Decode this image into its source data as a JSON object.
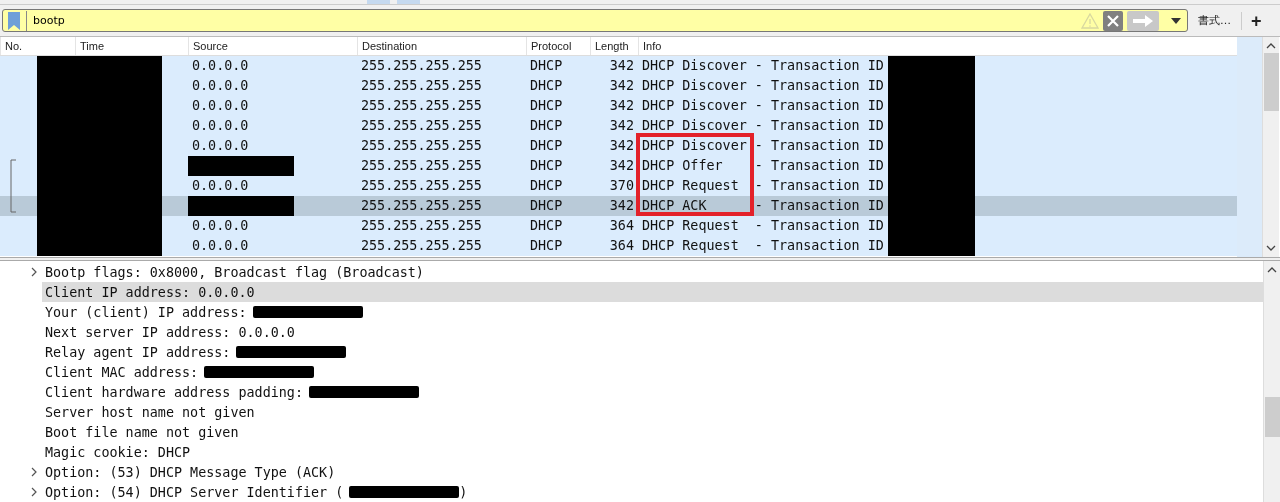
{
  "filter": {
    "value": "bootp",
    "format_label": "書式…",
    "add_label": "+"
  },
  "packet_list": {
    "columns": [
      "No.",
      "Time",
      "Source",
      "Destination",
      "Protocol",
      "Length",
      "Info"
    ],
    "rows": [
      {
        "source": "0.0.0.0",
        "source_redacted": false,
        "destination": "255.255.255.255",
        "protocol": "DHCP",
        "length": "342",
        "info": "DHCP Discover - Transaction ID",
        "related": false,
        "selected": false
      },
      {
        "source": "0.0.0.0",
        "source_redacted": false,
        "destination": "255.255.255.255",
        "protocol": "DHCP",
        "length": "342",
        "info": "DHCP Discover - Transaction ID",
        "related": false,
        "selected": false
      },
      {
        "source": "0.0.0.0",
        "source_redacted": false,
        "destination": "255.255.255.255",
        "protocol": "DHCP",
        "length": "342",
        "info": "DHCP Discover - Transaction ID",
        "related": false,
        "selected": false
      },
      {
        "source": "0.0.0.0",
        "source_redacted": false,
        "destination": "255.255.255.255",
        "protocol": "DHCP",
        "length": "342",
        "info": "DHCP Discover - Transaction ID",
        "related": false,
        "selected": false
      },
      {
        "source": "0.0.0.0",
        "source_redacted": false,
        "destination": "255.255.255.255",
        "protocol": "DHCP",
        "length": "342",
        "info": "DHCP Discover - Transaction ID",
        "related": false,
        "selected": false
      },
      {
        "source_redacted": true,
        "destination": "255.255.255.255",
        "protocol": "DHCP",
        "length": "342",
        "info": "DHCP Offer    - Transaction ID",
        "related": true,
        "selected": false
      },
      {
        "source": "0.0.0.0",
        "source_redacted": false,
        "destination": "255.255.255.255",
        "protocol": "DHCP",
        "length": "370",
        "info": "DHCP Request  - Transaction ID",
        "related": true,
        "selected": false
      },
      {
        "source_redacted": true,
        "destination": "255.255.255.255",
        "protocol": "DHCP",
        "length": "342",
        "info": "DHCP ACK      - Transaction ID",
        "related": true,
        "selected": true
      },
      {
        "source": "0.0.0.0",
        "source_redacted": false,
        "destination": "255.255.255.255",
        "protocol": "DHCP",
        "length": "364",
        "info": "DHCP Request  - Transaction ID",
        "related": false,
        "selected": false
      },
      {
        "source": "0.0.0.0",
        "source_redacted": false,
        "destination": "255.255.255.255",
        "protocol": "DHCP",
        "length": "364",
        "info": "DHCP Request  - Transaction ID",
        "related": false,
        "selected": false
      }
    ]
  },
  "details": [
    {
      "text": "Bootp flags: 0x8000, Broadcast flag (Broadcast)",
      "expandable": true,
      "redacted": false,
      "selected": false
    },
    {
      "text": "Client IP address: 0.0.0.0",
      "expandable": false,
      "redacted": false,
      "selected": true
    },
    {
      "text": "Your (client) IP address:",
      "expandable": false,
      "redacted": true,
      "selected": false
    },
    {
      "text": "Next server IP address: 0.0.0.0",
      "expandable": false,
      "redacted": false,
      "selected": false
    },
    {
      "text": "Relay agent IP address:",
      "expandable": false,
      "redacted": true,
      "selected": false
    },
    {
      "text": "Client MAC address:",
      "expandable": false,
      "redacted": true,
      "selected": false
    },
    {
      "text": "Client hardware address padding:",
      "expandable": false,
      "redacted": true,
      "selected": false
    },
    {
      "text": "Server host name not given",
      "expandable": false,
      "redacted": false,
      "selected": false
    },
    {
      "text": "Boot file name not given",
      "expandable": false,
      "redacted": false,
      "selected": false
    },
    {
      "text": "Magic cookie: DHCP",
      "expandable": false,
      "redacted": false,
      "selected": false
    },
    {
      "text": "Option: (53) DHCP Message Type (ACK)",
      "expandable": true,
      "redacted": false,
      "selected": false
    },
    {
      "text": "Option: (54) DHCP Server Identifier (",
      "expandable": true,
      "redacted": true,
      "suffix": ")",
      "selected": false
    }
  ]
}
